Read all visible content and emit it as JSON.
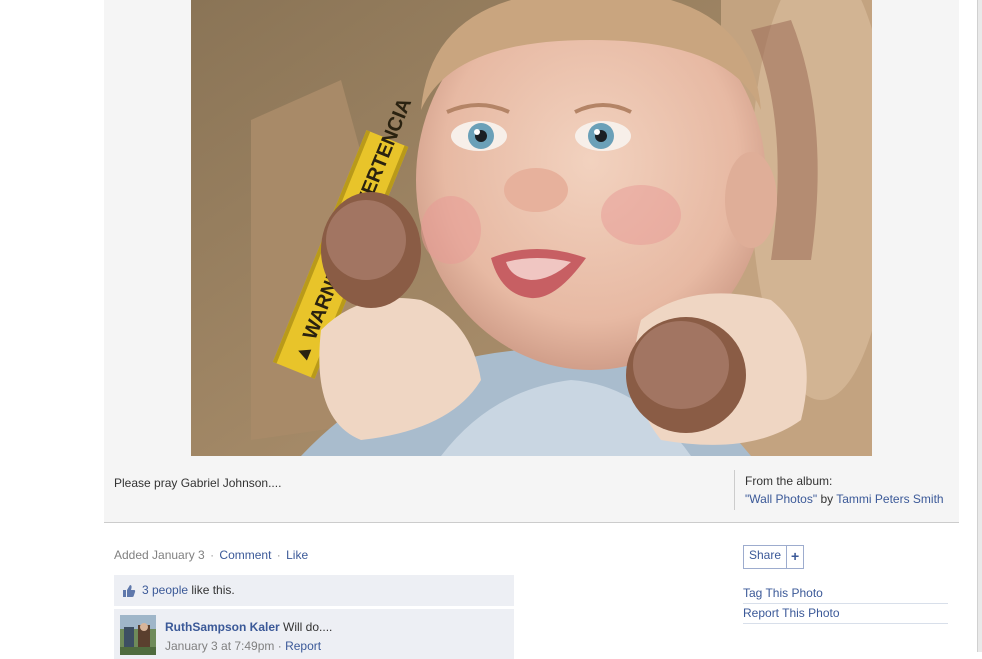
{
  "photo": {
    "caption": "Please pray Gabriel Johnson....",
    "album_label": "From the album:",
    "album_name": "\"Wall Photos\"",
    "album_by": " by ",
    "album_owner": "Tammi Peters Smith"
  },
  "meta": {
    "added": "Added January 3",
    "sep": "·",
    "comment": "Comment",
    "like": "Like"
  },
  "likes": {
    "count_link": "3 people",
    "suffix": " like this."
  },
  "comments": [
    {
      "name": "RuthSampson Kaler",
      "text": " Will do....",
      "date": "January 3 at 7:49pm",
      "sep": " · ",
      "report": "Report"
    }
  ],
  "sidebar": {
    "share_label": "Share",
    "share_plus": "+",
    "tag_label": "Tag This Photo",
    "report_label": "Report This Photo"
  },
  "colors": {
    "link": "#3b5998",
    "panel": "#edeff4",
    "stage": "#f5f5f5"
  },
  "icons": {
    "like": "thumbs-up-icon",
    "share": "plus-icon"
  }
}
